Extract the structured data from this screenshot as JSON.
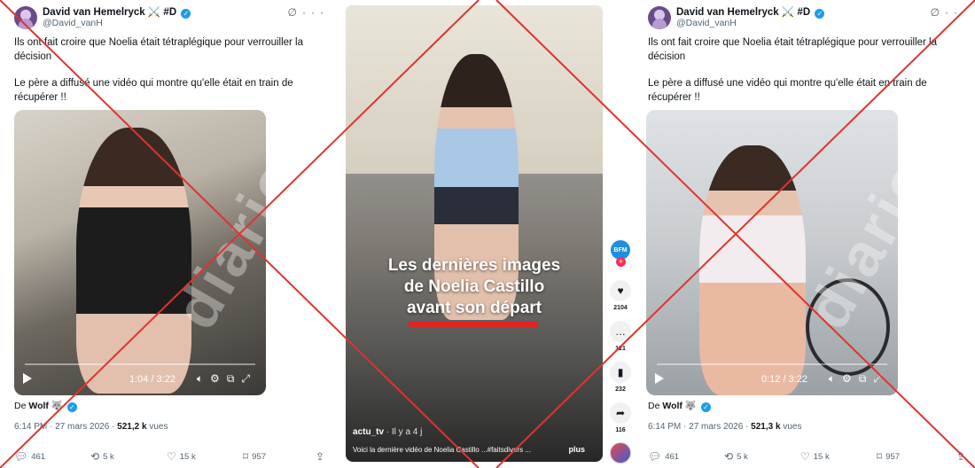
{
  "tweets": {
    "left": {
      "author": "David van Hemelryck",
      "author_badges": "⚔️ #D",
      "handle": "@David_vanH",
      "text1": "Ils ont fait croire que Noelia était tétraplégique pour verrouiller la décision",
      "text2": "Le père a diffusé une vidéo qui montre qu'elle était en train de récupérer !!",
      "watermark": "diario",
      "video_time": "1:04 / 3:22",
      "from_label": "De",
      "from_name": "Wolf",
      "from_emoji": "🐺",
      "timestamp": "6:14 PM · 27 mars 2026 ·",
      "views_count": "521,2 k",
      "views_label": "vues",
      "replies": "461",
      "retweets": "5 k",
      "likes": "15 k",
      "bookmarks": "957"
    },
    "right": {
      "author": "David van Hemelryck",
      "author_badges": "⚔️ #D",
      "handle": "@David_vanH",
      "text1": "Ils ont fait croire que Noelia était tétraplégique pour verrouiller la décision",
      "text2": "Le père a diffusé une vidéo qui montre qu'elle était en train de récupérer !!",
      "watermark": "diario",
      "video_time": "0:12 / 3:22",
      "from_label": "De",
      "from_name": "Wolf",
      "from_emoji": "🐺",
      "timestamp": "6:14 PM · 27 mars 2026 ·",
      "views_count": "521,3 k",
      "views_label": "vues",
      "replies": "461",
      "retweets": "5 k",
      "likes": "15 k",
      "bookmarks": "957"
    }
  },
  "tiktok": {
    "caption_line1": "Les dernières images",
    "caption_line2": "de Noelia Castillo",
    "caption_line3": "avant son départ",
    "username": "actu_tv",
    "posted": "· Il y a 4 j",
    "description": "Voici la dernière vidéo de Noelia Castillo ...#faitsdivers ...",
    "more_label": "plus",
    "account_avatar": "BFM",
    "likes": "2104",
    "comments": "121",
    "saves": "232",
    "shares": "116"
  },
  "colors": {
    "verified": "#1d9bf0",
    "cross": "#e0332d",
    "caption_bar": "#e02424",
    "secondary_text": "#536471"
  }
}
